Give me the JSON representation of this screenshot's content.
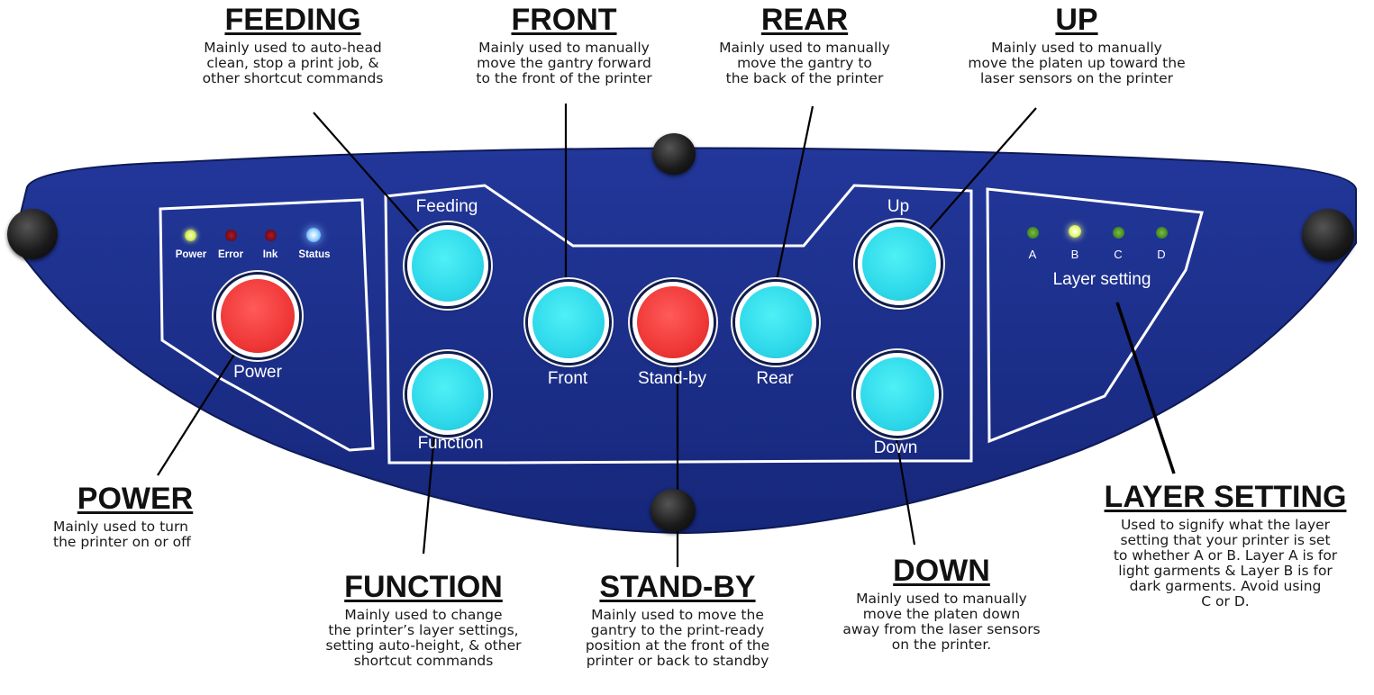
{
  "panel": {
    "led_labels": [
      "Power",
      "Error",
      "Ink",
      "Status"
    ],
    "layer_led_labels": [
      "A",
      "B",
      "C",
      "D"
    ],
    "layer_setting_label": "Layer setting",
    "buttons": {
      "power": "Power",
      "feeding": "Feeding",
      "function": "Function",
      "front": "Front",
      "standby": "Stand-by",
      "rear": "Rear",
      "up": "Up",
      "down": "Down"
    }
  },
  "callouts": {
    "feeding": {
      "title": "FEEDING",
      "lines": [
        "Mainly used to auto-head",
        "clean, stop a print job, &",
        "other shortcut commands"
      ]
    },
    "front": {
      "title": "FRONT",
      "lines": [
        "Mainly used to manually",
        "move the gantry forward",
        "to the front of the printer"
      ]
    },
    "rear": {
      "title": "REAR",
      "lines": [
        "Mainly used to manually",
        "move the gantry to",
        "the back of the printer"
      ]
    },
    "up": {
      "title": "UP",
      "lines": [
        "Mainly used to manually",
        "move the platen up toward the",
        "laser sensors on the printer"
      ]
    },
    "power": {
      "title": "POWER",
      "lines": [
        "Mainly used to turn",
        "the printer on or off"
      ]
    },
    "function": {
      "title": "FUNCTION",
      "lines": [
        "Mainly used to change",
        "the printer’s layer settings,",
        "setting auto-height, & other",
        "shortcut commands"
      ]
    },
    "standby": {
      "title": "STAND-BY",
      "lines": [
        "Mainly used to move the",
        "gantry to the print-ready",
        "position at the front of the",
        "printer or back to standby"
      ]
    },
    "down": {
      "title": "DOWN",
      "lines": [
        "Mainly used to manually",
        "move the platen down",
        "away from the laser sensors",
        "on the printer."
      ]
    },
    "layer": {
      "title": "LAYER SETTING",
      "lines": [
        "Used to signify what the layer",
        "setting that your printer is set",
        "to whether A or B. Layer A is for",
        "light garments & Layer B is for",
        "dark garments. Avoid using",
        "C or D."
      ]
    }
  },
  "colors": {
    "panel_blue": "#1b2f8c",
    "button_cyan": "#2fd9ea",
    "button_red": "#f03838",
    "led_power": "#d8f06a",
    "led_error": "#6a0d18",
    "led_ink": "#6a0d18",
    "led_status": "#9fd8ff",
    "layer_led_b": "#e9ff7a",
    "layer_led_dim": "#3a7a20"
  }
}
